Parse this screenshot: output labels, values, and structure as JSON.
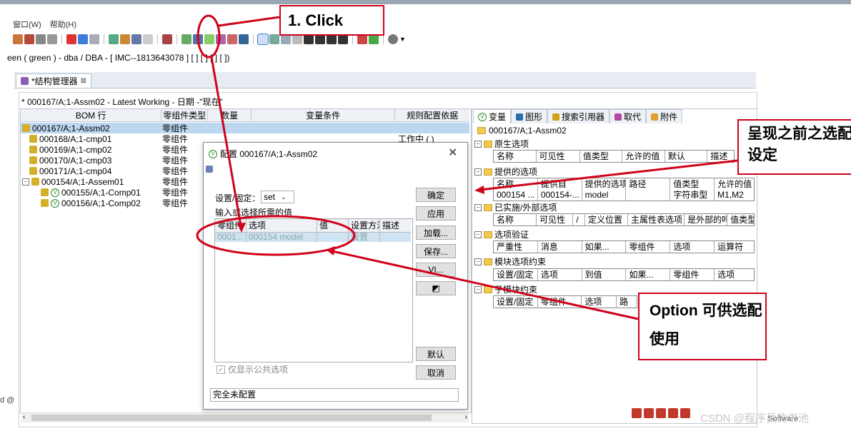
{
  "menu": {
    "items": [
      "窗口(W)",
      "帮助(H)"
    ]
  },
  "context_line": "een ( green ) - dba / DBA - [ IMC--1813643078 ] [ ] [ ] [ ] [ ])",
  "view_tab": {
    "label": "*结构管理器"
  },
  "pane_header": "* 000167/A;1-Assm02 - Latest Working - 日期 -\"现在\"",
  "tree": {
    "columns": [
      "BOM 行",
      "零组件类型",
      "数量",
      "变量条件",
      "规则配置依据"
    ],
    "rows": [
      {
        "name": "000167/A;1-Assm02",
        "type": "零组件",
        "status": ""
      },
      {
        "name": "000168/A;1-cmp01",
        "type": "零组件",
        "status": "工作中 ( )"
      },
      {
        "name": "000169/A;1-cmp02",
        "type": "零组件",
        "status": ""
      },
      {
        "name": "000170/A;1-cmp03",
        "type": "零组件",
        "status": ""
      },
      {
        "name": "000171/A;1-cmp04",
        "type": "零组件",
        "status": ""
      },
      {
        "name": "000154/A;1-Assem01",
        "type": "零组件",
        "status": ""
      },
      {
        "name": "000155/A;1-Comp01",
        "type": "零组件",
        "status": ""
      },
      {
        "name": "000156/A;1-Comp02",
        "type": "零组件",
        "status": ""
      }
    ]
  },
  "right": {
    "tabs": [
      "变量",
      "图形",
      "搜索引用器",
      "取代",
      "附件"
    ],
    "title": "000167/A;1-Assm02",
    "sections": [
      {
        "label": "原生选项",
        "columns": [
          "名称",
          "可见性",
          "值类型",
          "允许的值",
          "默认",
          "描述"
        ]
      },
      {
        "label": "提供的选项",
        "columns": [
          "名称",
          "提供自",
          "提供的选项",
          "路径",
          "值类型",
          "允许的值"
        ],
        "row": [
          "000154 ...",
          "000154-...",
          "model",
          "",
          "字符串型",
          "M1,M2"
        ]
      },
      {
        "label": "已实施/外部选项",
        "columns": [
          "名称",
          "可见性",
          "/",
          "定义位置",
          "主属性表选项",
          "是外部的吗",
          "值类型"
        ]
      },
      {
        "label": "选项验证",
        "columns": [
          "严重性",
          "消息",
          "如果...",
          "零组件",
          "选项",
          "运算符"
        ]
      },
      {
        "label": "模块选项约束",
        "columns": [
          "设置/固定",
          "选项",
          "到值",
          "如果...",
          "零组件",
          "选项"
        ]
      },
      {
        "label": "子模块约束",
        "columns": [
          "设置/固定",
          "零组件",
          "选项",
          "路",
          "",
          ""
        ]
      }
    ]
  },
  "dialog": {
    "title": "配置 000167/A;1-Assm02",
    "set_label": "设置/固定：",
    "set_value": "set",
    "instruction": "输入或选择所需的值",
    "table_columns": [
      "零组件",
      "选项",
      "值",
      "设置方法",
      "描述"
    ],
    "table_row": [
      "0001...",
      "000154 model",
      "",
      "设置",
      ""
    ],
    "buttons": [
      "确定",
      "应用",
      "加载...",
      "保存...",
      "VI...",
      "◩",
      "默认",
      "取消"
    ],
    "checkbox_label": "仅显示公共选项",
    "status": "完全未配置"
  },
  "callouts": {
    "click": "1. Click",
    "present": "呈现之前之选配设定",
    "option": "Option 可供选配使用"
  },
  "watermark": "CSDN @程序员的书池",
  "bottom_text": "Software",
  "left_cut": "d @",
  "colors": {
    "accent": "#d0021b",
    "selection": "#bcd7ef"
  }
}
